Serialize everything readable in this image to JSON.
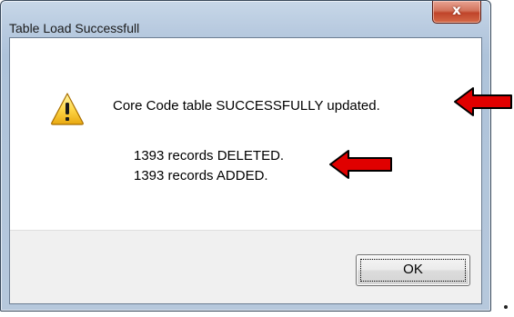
{
  "window": {
    "title": "Table Load Successfull",
    "close_glyph": "x"
  },
  "message": {
    "main": "Core Code table  SUCCESSFULLY  updated.",
    "deleted_line": "1393  records DELETED.",
    "added_line": "1393  records ADDED.",
    "icon": "warning-icon"
  },
  "buttons": {
    "ok_label": "OK"
  },
  "annotations": {
    "arrow_color": "#e00000"
  }
}
